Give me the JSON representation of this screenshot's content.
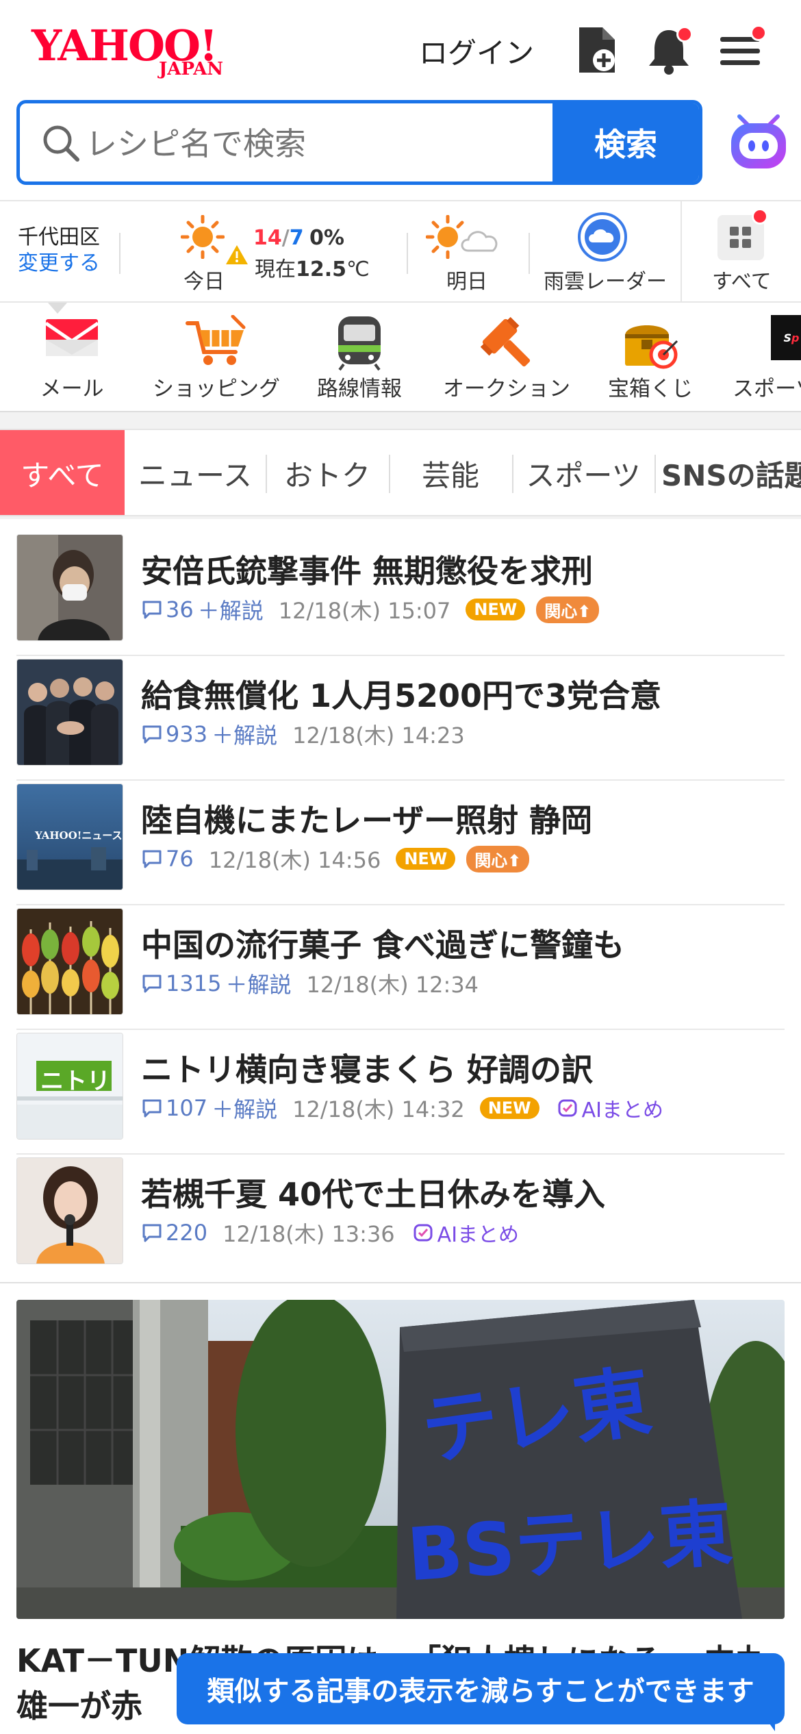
{
  "header": {
    "logo_main": "YAHOO!",
    "logo_sub": "JAPAN",
    "login_label": "ログイン"
  },
  "search": {
    "placeholder": "レシピ名で検索",
    "button_label": "検索"
  },
  "weather": {
    "area": "千代田区",
    "change_label": "変更する",
    "today_label": "今日",
    "today_high": "14",
    "today_slash": "/",
    "today_low": "7",
    "today_precip": "0%",
    "now_label": "現在",
    "now_temp": "12.5",
    "now_unit": "℃",
    "tomorrow_label": "明日",
    "radar_label": "雨雲レーダー",
    "all_label": "すべて"
  },
  "services": [
    {
      "label": "メール",
      "icon": "mail-icon"
    },
    {
      "label": "ショッピング",
      "icon": "shopping-cart-icon"
    },
    {
      "label": "路線情報",
      "icon": "train-icon"
    },
    {
      "label": "オークション",
      "icon": "gavel-icon"
    },
    {
      "label": "宝箱くじ",
      "icon": "treasure-box-icon"
    },
    {
      "label": "スポーツ",
      "icon": "sports-icon"
    }
  ],
  "tabs": [
    "すべて",
    "ニュース",
    "おトク",
    "芸能",
    "スポーツ",
    "SNSの話題"
  ],
  "news": [
    {
      "title": "安倍氏銃撃事件 無期懲役を求刑",
      "comments": "36",
      "plus": "＋解説",
      "time": "12/18(木) 15:07",
      "new": "NEW",
      "interest": "関心"
    },
    {
      "title": "給食無償化 1人月5200円で3党合意",
      "comments": "933",
      "plus": "＋解説",
      "time": "12/18(木) 14:23"
    },
    {
      "title": "陸自機にまたレーザー照射 静岡",
      "comments": "76",
      "time": "12/18(木) 14:56",
      "new": "NEW",
      "interest": "関心"
    },
    {
      "title": "中国の流行菓子 食べ過ぎに警鐘も",
      "comments": "1315",
      "plus": "＋解説",
      "time": "12/18(木) 12:34"
    },
    {
      "title": "ニトリ横向き寝まくら 好調の訳",
      "comments": "107",
      "plus": "＋解説",
      "time": "12/18(木) 14:32",
      "new": "NEW",
      "ai": "AIまとめ"
    },
    {
      "title": "若槻千夏 40代で土日休みを導入",
      "comments": "220",
      "time": "12/18(木) 13:36",
      "ai": "AIまとめ"
    }
  ],
  "feature": {
    "sign_top": "テレ東",
    "sign_bottom": "BSテレ東",
    "title": "KAT－TUN解散の原因は…「犯人捜しになる」 中丸雄一が赤"
  },
  "thumb_texts": {
    "yahoo_news": "YAHOO!ニュース",
    "nitori": "ニトリ"
  },
  "toast": "類似する記事の表示を減らすことができます",
  "colors": {
    "brand": "#ff0033",
    "accent": "#1a73e8",
    "tab_active": "#ff5b67"
  }
}
